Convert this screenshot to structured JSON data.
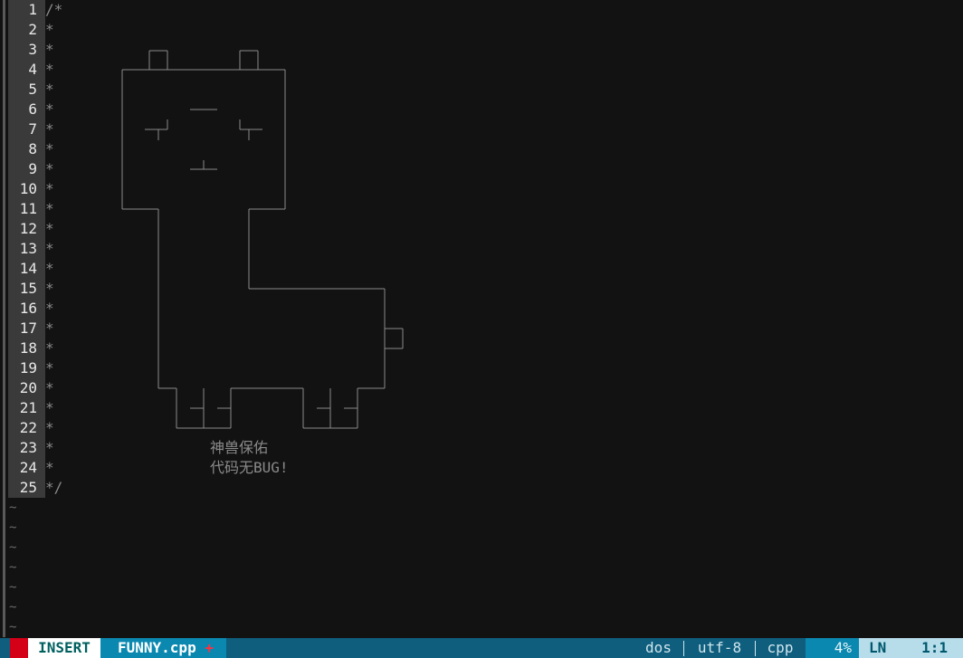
{
  "editor": {
    "lines": [
      {
        "num": "1",
        "text": "/*"
      },
      {
        "num": "2",
        "text": "*"
      },
      {
        "num": "3",
        "text": "*"
      },
      {
        "num": "4",
        "text": "*"
      },
      {
        "num": "5",
        "text": "*"
      },
      {
        "num": "6",
        "text": "*"
      },
      {
        "num": "7",
        "text": "*"
      },
      {
        "num": "8",
        "text": "*"
      },
      {
        "num": "9",
        "text": "*"
      },
      {
        "num": "10",
        "text": "*"
      },
      {
        "num": "11",
        "text": "*"
      },
      {
        "num": "12",
        "text": "*"
      },
      {
        "num": "13",
        "text": "*"
      },
      {
        "num": "14",
        "text": "*"
      },
      {
        "num": "15",
        "text": "*"
      },
      {
        "num": "16",
        "text": "*"
      },
      {
        "num": "17",
        "text": "*"
      },
      {
        "num": "18",
        "text": "*"
      },
      {
        "num": "19",
        "text": "*"
      },
      {
        "num": "20",
        "text": "*"
      },
      {
        "num": "21",
        "text": "*"
      },
      {
        "num": "22",
        "text": "*"
      },
      {
        "num": "23",
        "text": "*"
      },
      {
        "num": "24",
        "text": "*"
      },
      {
        "num": "25",
        "text": "*/"
      }
    ],
    "empty_marker": "~",
    "empty_line_count": 7,
    "caption_line1": "神兽保佑",
    "caption_line2": "代码无BUG!"
  },
  "statusline": {
    "mode": "INSERT",
    "filename": "FUNNY.cpp",
    "modified_marker": "+",
    "fileformat": "dos",
    "encoding": "utf-8",
    "filetype": "cpp",
    "percent": "4%",
    "ln_label": "LN",
    "position": "1:1"
  },
  "colors": {
    "background": "#121212",
    "statusline": "#0f5e7d",
    "mode_fg": "#005f5f",
    "file_bg": "#0a88b0",
    "modified": "#ff3040",
    "position_bg": "#b6dde9"
  }
}
